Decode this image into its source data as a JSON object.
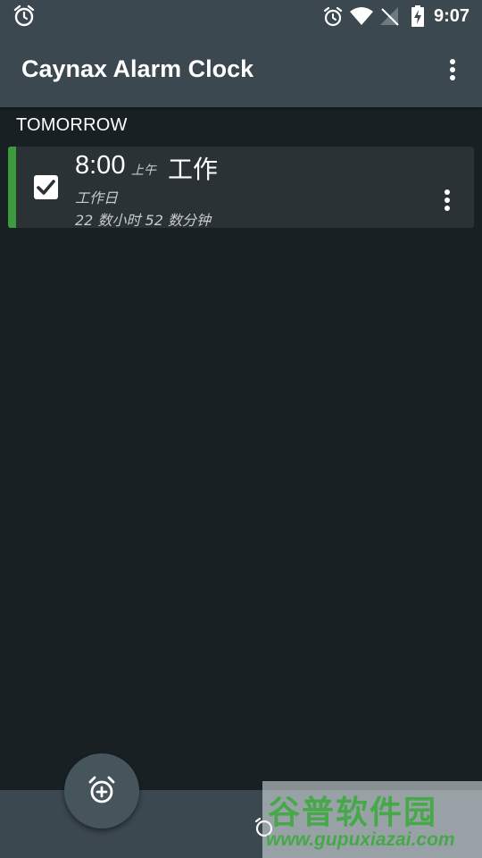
{
  "status_bar": {
    "time": "9:07",
    "icons": [
      "alarm-icon",
      "alarm-icon",
      "wifi-icon",
      "no-signal-icon",
      "battery-charging-icon"
    ]
  },
  "app_bar": {
    "title": "Caynax Alarm Clock",
    "menu_icon": "overflow-menu-icon"
  },
  "section": {
    "header": "TOMORROW"
  },
  "alarms": [
    {
      "time": "8:00",
      "ampm": "上午",
      "label": "工作",
      "repeat": "工作日",
      "remaining": "22 数小时 52 数分钟",
      "enabled": true,
      "accent_color": "#3d9b3e"
    }
  ],
  "fab": {
    "icon": "add-alarm-icon"
  },
  "watermark": {
    "title": "谷普软件园",
    "url": "www.gupuxiazai.com"
  },
  "colors": {
    "toolbar": "#3b484f",
    "background": "#182023",
    "card": "#2a3236",
    "accent": "#3d9b3e"
  }
}
